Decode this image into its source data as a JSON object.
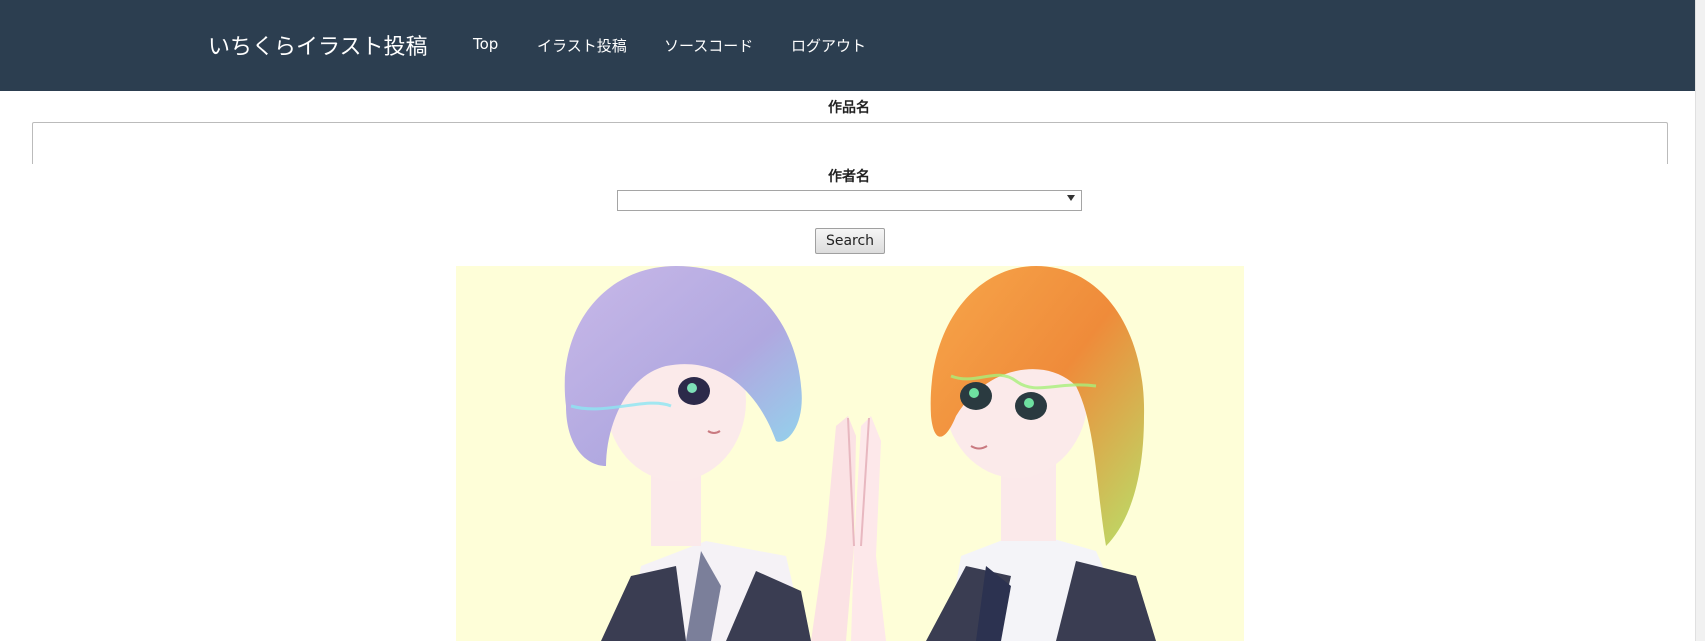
{
  "navbar": {
    "brand": "いちくらイラスト投稿",
    "links": [
      "Top",
      "イラスト投稿",
      "ソースコード",
      "ログアウト"
    ],
    "background": "#2c3e50"
  },
  "form": {
    "title_label": "作品名",
    "title_value": "",
    "author_label": "作者名",
    "author_selected": "",
    "search_label": "Search"
  }
}
